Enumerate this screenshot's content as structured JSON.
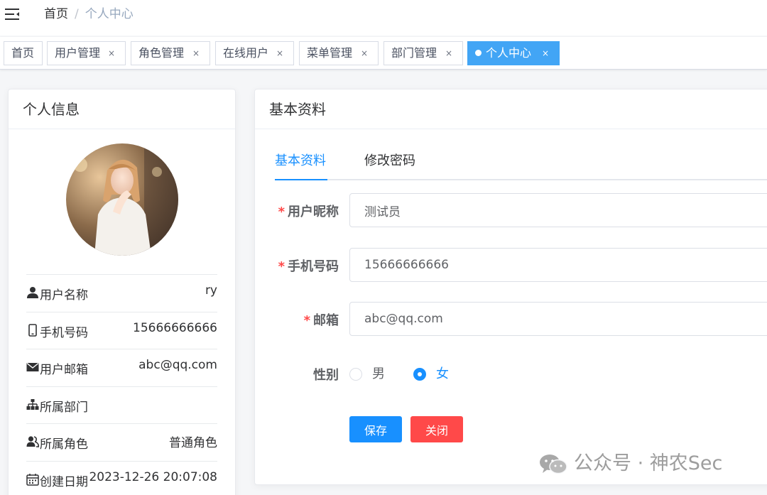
{
  "breadcrumb": {
    "home": "首页",
    "separator": "/",
    "current": "个人中心"
  },
  "tags": [
    {
      "label": "首页",
      "closable": false
    },
    {
      "label": "用户管理",
      "closable": true
    },
    {
      "label": "角色管理",
      "closable": true
    },
    {
      "label": "在线用户",
      "closable": true
    },
    {
      "label": "菜单管理",
      "closable": true
    },
    {
      "label": "部门管理",
      "closable": true
    },
    {
      "label": "个人中心",
      "closable": true,
      "active": true
    }
  ],
  "tag_close_glyph": "×",
  "profile": {
    "title": "个人信息",
    "rows": [
      {
        "icon": "user-icon",
        "label": "用户名称",
        "value": "ry"
      },
      {
        "icon": "phone-icon",
        "label": "手机号码",
        "value": "15666666666"
      },
      {
        "icon": "mail-icon",
        "label": "用户邮箱",
        "value": "abc@qq.com"
      },
      {
        "icon": "tree-icon",
        "label": "所属部门",
        "value": ""
      },
      {
        "icon": "peoples-icon",
        "label": "所属角色",
        "value": "普通角色"
      },
      {
        "icon": "date-icon",
        "label": "创建日期",
        "value": "2023-12-26 20:07:08"
      }
    ]
  },
  "basic": {
    "title": "基本资料",
    "tabs": {
      "active": "基本资料",
      "inactive": "修改密码"
    },
    "form": {
      "required_mark": "*",
      "nickname": {
        "label": "用户昵称",
        "value": "测试员"
      },
      "phone": {
        "label": "手机号码",
        "value": "15666666666"
      },
      "email": {
        "label": "邮箱",
        "value": "abc@qq.com"
      },
      "sex": {
        "label": "性别",
        "options": [
          "男",
          "女"
        ],
        "selected": "女"
      }
    },
    "buttons": {
      "save": "保存",
      "close": "关闭"
    }
  },
  "watermark": {
    "text": "公众号 · 神农Sec"
  },
  "colors": {
    "primary": "#1890ff",
    "danger": "#ff4949",
    "active_tag": "#42a5f5",
    "muted": "#97a8be"
  }
}
